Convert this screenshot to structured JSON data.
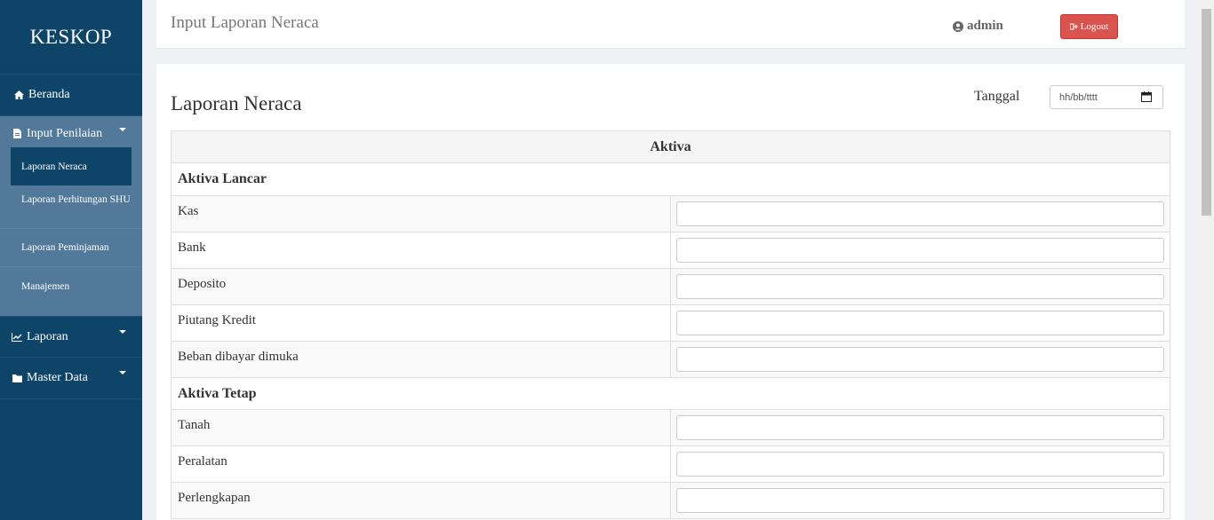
{
  "sidebar": {
    "brand": "KESKOP",
    "beranda": "Beranda",
    "input_penilaian": {
      "label": "Input Penilaian",
      "items": [
        "Laporan Neraca",
        "Laporan Perhitungan SHU",
        "Laporan Peminjaman",
        "Manajemen"
      ]
    },
    "laporan": "Laporan",
    "master_data": "Master Data"
  },
  "header": {
    "title": "Input Laporan Neraca",
    "user": "admin",
    "logout_label": "Logout"
  },
  "main": {
    "section_title": "Laporan Neraca",
    "tanggal_label": "Tanggal",
    "tanggal_placeholder": "hh/bb/tttt",
    "table": {
      "header": "Aktiva",
      "group1": "Aktiva Lancar",
      "group1_rows": [
        "Kas",
        "Bank",
        "Deposito",
        "Piutang Kredit",
        "Beban dibayar dimuka"
      ],
      "group2": "Aktiva Tetap",
      "group2_rows": [
        "Tanah",
        "Peralatan",
        "Perlengkapan"
      ]
    }
  },
  "colors": {
    "sidebar_bg": "#0e4468",
    "submenu_bg": "#52799a",
    "logout_bg": "#d9534f"
  }
}
